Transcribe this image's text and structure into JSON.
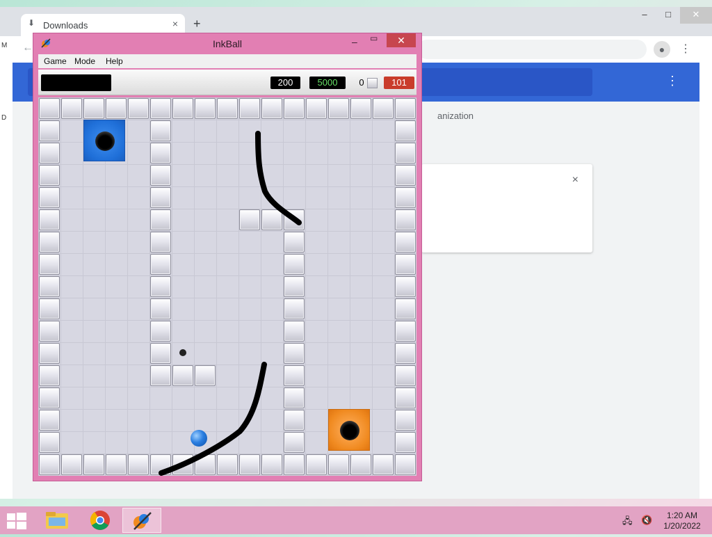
{
  "browser": {
    "tab_title": "Downloads",
    "new_tab_symbol": "+",
    "tab_close_symbol": "×",
    "minimize_symbol": "–",
    "maximize_symbol": "□",
    "close_symbol": "✕",
    "back_symbol": "←",
    "menu_symbol": "⋮",
    "partial_text": "anization",
    "card_close_symbol": "×",
    "left_edge_letters": [
      "M",
      "D"
    ]
  },
  "inkball": {
    "title": "InkBall",
    "menu": [
      "Game",
      "Mode",
      "Help"
    ],
    "score_value": "200",
    "bonus_value": "5000",
    "tiles_count": "0",
    "time_value": "101",
    "title_buttons": {
      "minimize": "–",
      "maximize": "▭",
      "close": "✕"
    },
    "colors": {
      "blue_hole": "#1f6fd8",
      "orange_hole": "#f08a20",
      "ball": "#2a7ee0",
      "timer": "#c93c2b",
      "bonus_text": "#66e066"
    },
    "icons": [
      "inkball-app-icon",
      "blue-hole-icon",
      "orange-hole-icon",
      "blue-ball-icon",
      "gray-hole-icon",
      "ink-stroke"
    ]
  },
  "taskbar": {
    "apps": [
      "file-explorer-icon",
      "chrome-icon",
      "inkball-icon"
    ],
    "time": "1:20 AM",
    "date": "1/20/2022"
  }
}
